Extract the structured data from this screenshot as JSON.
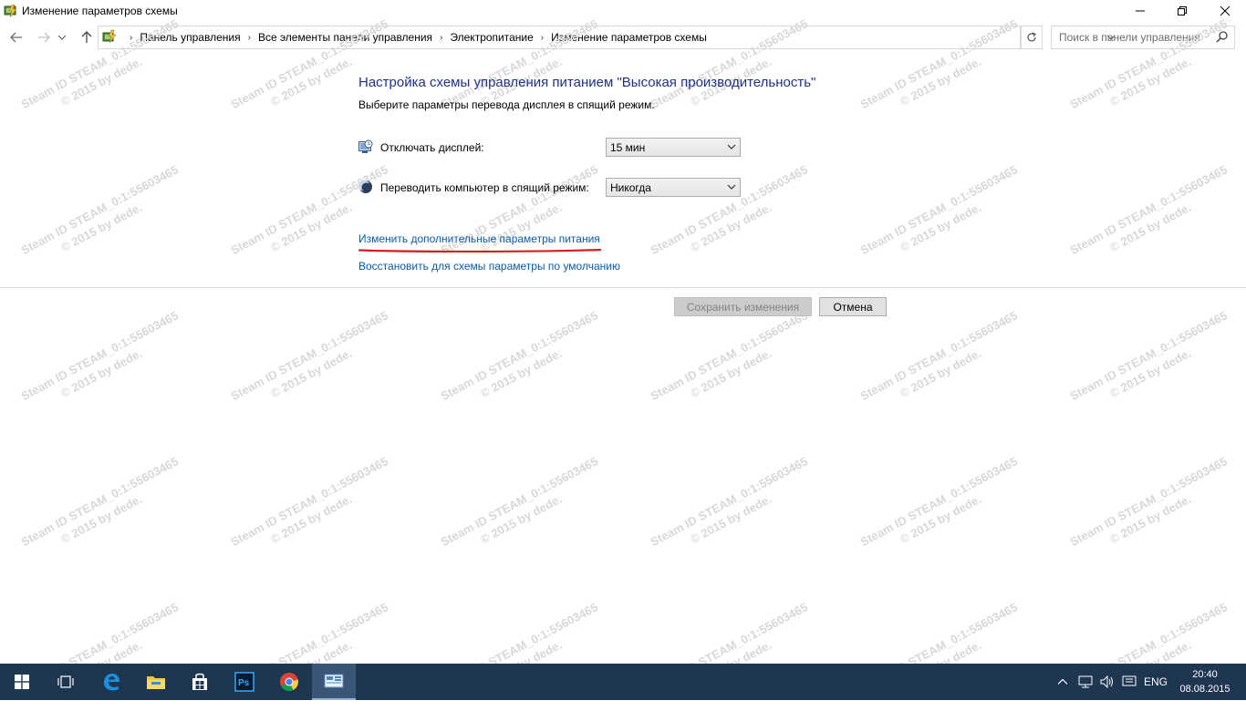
{
  "window": {
    "title": "Изменение параметров схемы"
  },
  "address_bar": {
    "breadcrumbs": [
      "Панель управления",
      "Все элементы панели управления",
      "Электропитание",
      "Изменение параметров схемы"
    ],
    "search_placeholder": "Поиск в панели управления"
  },
  "content": {
    "heading": "Настройка схемы управления питанием \"Высокая производительность\"",
    "subtext": "Выберите параметры перевода дисплея в спящий режим.",
    "options": [
      {
        "label": "Отключать дисплей:",
        "value": "15 мин",
        "icon": "monitor-clock-icon"
      },
      {
        "label": "Переводить компьютер в спящий режим:",
        "value": "Никогда",
        "icon": "moon-icon"
      }
    ],
    "links": {
      "advanced": "Изменить дополнительные параметры питания",
      "restore": "Восстановить для схемы параметры по умолчанию"
    },
    "buttons": {
      "save": "Сохранить изменения",
      "cancel": "Отмена"
    }
  },
  "watermark": {
    "line1": "Steam ID  STEAM_0:1:55603465",
    "line2": "© 2015 by dede."
  },
  "taskbar": {
    "items": [
      "windows-start-icon",
      "task-view-icon",
      "edge-icon",
      "file-explorer-icon",
      "store-icon",
      "photoshop-icon",
      "chrome-icon",
      "control-panel-icon"
    ],
    "tray_language": "ENG",
    "time": "20:40",
    "date": "08.08.2015"
  },
  "colors": {
    "heading": "#1e3287",
    "link": "#0a5ba8",
    "taskbar": "#1f3651",
    "annotation_underline": "#d21f1f"
  }
}
